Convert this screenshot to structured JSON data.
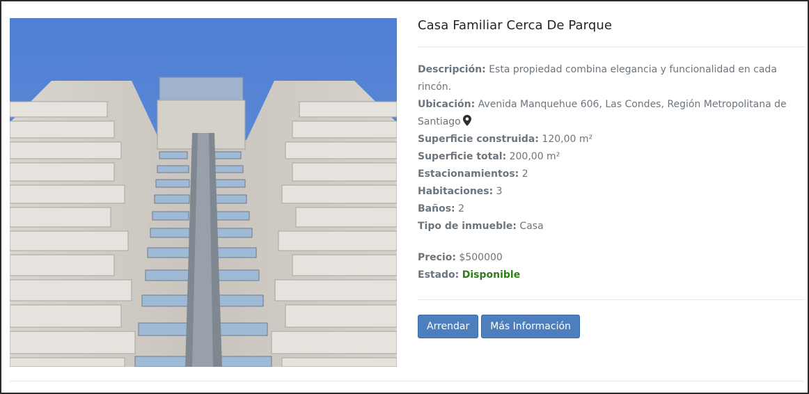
{
  "property": {
    "title": "Casa Familiar Cerca De Parque",
    "image_alt": "building-photo",
    "fields": [
      {
        "label": "Descripción:",
        "value": " Esta propiedad combina elegancia y funcionalidad en cada rincón."
      },
      {
        "label": "Ubicación:",
        "value": " Avenida Manquehue 606, Las Condes, Región Metropolitana de Santiago"
      },
      {
        "label": "Superficie construida:",
        "value": " 120,00 m²"
      },
      {
        "label": "Superficie total:",
        "value": " 200,00 m²"
      },
      {
        "label": "Estacionamientos:",
        "value": " 2"
      },
      {
        "label": "Habitaciones:",
        "value": " 3"
      },
      {
        "label": "Baños:",
        "value": " 2"
      },
      {
        "label": "Tipo de inmueble:",
        "value": " Casa"
      }
    ],
    "price": {
      "label": "Precio:",
      "value": " $500000"
    },
    "status": {
      "label": "Estado:",
      "value": "Disponible"
    },
    "location_icon": "map-pin-icon",
    "status_color": "#2e7d17",
    "button_color": "#4d7ebe"
  },
  "actions": {
    "rent_label": "Arrendar",
    "info_label": "Más Información"
  }
}
